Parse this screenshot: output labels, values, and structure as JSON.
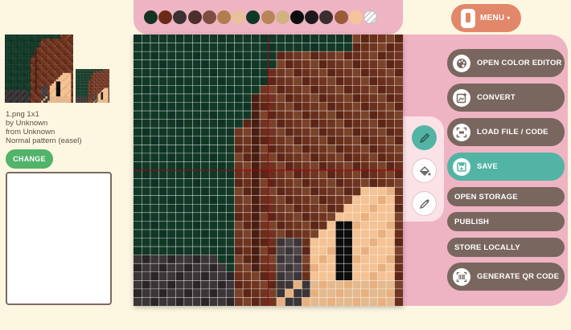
{
  "palette": {
    "colors": [
      "#133323",
      "#6b2a18",
      "#3a3233",
      "#4c2f2a",
      "#7e4d42",
      "#b07d4c",
      "#e9c09a",
      "#0f3927",
      "#b88558",
      "#d2b183",
      "#0d0d0d",
      "#1d1a1e",
      "#3a2e30",
      "#9a5b38",
      "#f6c49a"
    ],
    "clear_icon": "transparent-swatch-icon"
  },
  "menu": {
    "label": "MENU",
    "icon": "phone-icon",
    "caret": "▾"
  },
  "tools": [
    {
      "name": "pencil",
      "icon": "pencil-icon",
      "active": true
    },
    {
      "name": "fill",
      "icon": "paint-bucket-icon",
      "active": false
    },
    {
      "name": "picker",
      "icon": "eyedropper-icon",
      "active": false
    }
  ],
  "actions": {
    "open_color_editor": "OPEN COLOR EDITOR",
    "convert": "CONVERT",
    "load_file": "LOAD FILE / CODE",
    "save": "SAVE",
    "open_storage": "OPEN STORAGE",
    "publish": "PUBLISH",
    "store_locally": "STORE LOCALLY",
    "generate_qr": "GENERATE QR CODE"
  },
  "pattern_info": {
    "filename": "1.png 1x1",
    "author": "by Unknown",
    "town": "from Unknown",
    "type": "Normal pattern (easel)",
    "change_label": "CHANGE",
    "notes": ""
  },
  "grid": {
    "columns": 32,
    "rows": 32,
    "guide_color": "#a8001c",
    "line_color": "#ffffff"
  }
}
